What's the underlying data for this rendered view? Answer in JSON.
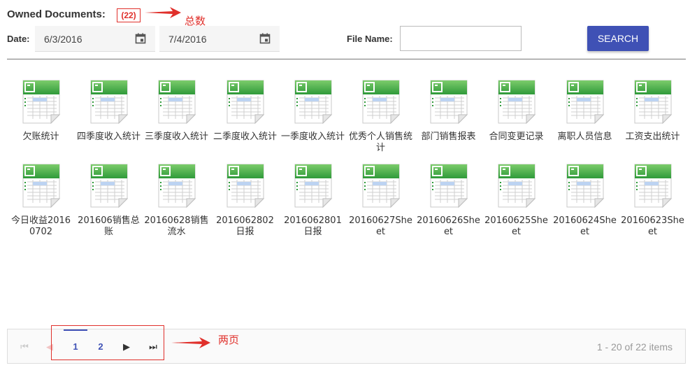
{
  "header": {
    "title": "Owned Documents:",
    "count": "(22)",
    "count_annotation": "总数"
  },
  "filters": {
    "date_label": "Date:",
    "date_from": "6/3/2016",
    "date_to": "7/4/2016",
    "file_name_label": "File Name:",
    "file_name_value": "",
    "search_label": "SEARCH"
  },
  "documents": [
    {
      "name": "欠账统计"
    },
    {
      "name": "四季度收入统计"
    },
    {
      "name": "三季度收入统计"
    },
    {
      "name": "二季度收入统计"
    },
    {
      "name": "一季度收入统计"
    },
    {
      "name": "优秀个人销售统计"
    },
    {
      "name": "部门销售报表"
    },
    {
      "name": "合同变更记录"
    },
    {
      "name": "离职人员信息"
    },
    {
      "name": "工资支出统计"
    },
    {
      "name": "今日收益20160702"
    },
    {
      "name": "201606销售总账"
    },
    {
      "name": "20160628销售流水"
    },
    {
      "name": "2016062802日报"
    },
    {
      "name": "2016062801日报"
    },
    {
      "name": "20160627Sheet"
    },
    {
      "name": "20160626Sheet"
    },
    {
      "name": "20160625Sheet"
    },
    {
      "name": "20160624Sheet"
    },
    {
      "name": "20160623Sheet"
    }
  ],
  "pager": {
    "pages": [
      "1",
      "2"
    ],
    "current_page": "1",
    "info": "1 - 20 of 22 items",
    "annotation": "两页"
  },
  "colors": {
    "accent": "#3f51b5",
    "annotation": "#e0302b",
    "icon_green": "#4caf50"
  }
}
